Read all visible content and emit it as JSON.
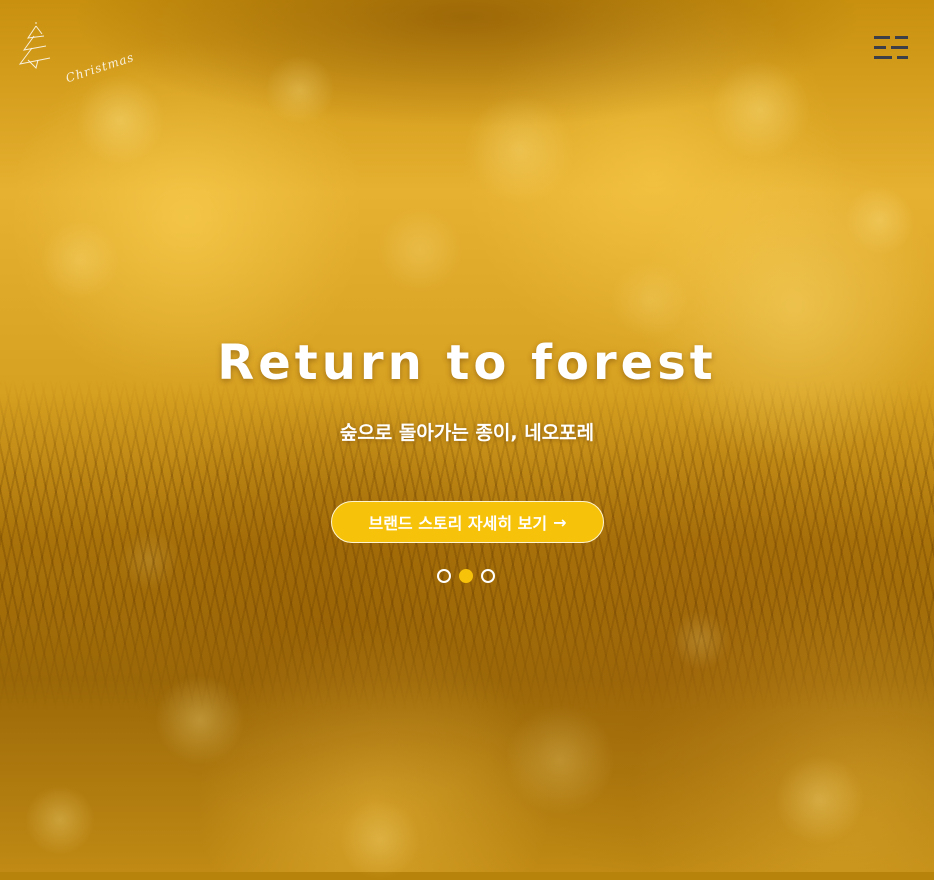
{
  "logo": {
    "text": "Christmas",
    "icon": "christmas-tree-icon"
  },
  "menu": {
    "icon": "hamburger-menu-icon"
  },
  "hero": {
    "title": "Return to forest",
    "subtitle": "숲으로 돌아가는 종이, 네오포레",
    "cta_label": "브랜드 스토리 자세히 보기",
    "cta_arrow": "→",
    "slide_count": 3,
    "active_slide": 2
  },
  "colors": {
    "accent": "#f6c20a",
    "text": "#ffffff",
    "menu_icon": "#3c3f48"
  }
}
